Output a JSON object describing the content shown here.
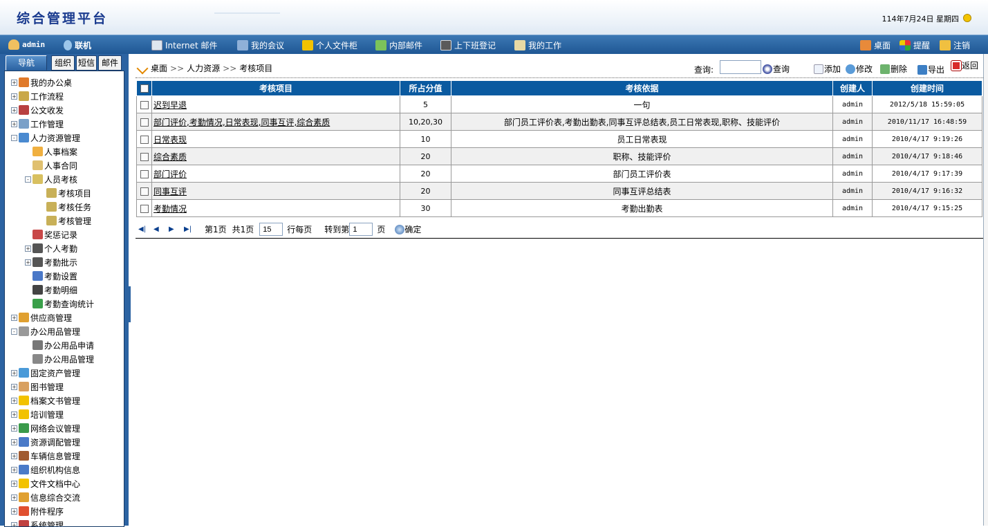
{
  "header": {
    "title": "综合管理平台",
    "date": "114年7月24日",
    "weekday": "星期四"
  },
  "menubar": {
    "user": "admin",
    "status": "联机",
    "items": [
      "Internet 邮件",
      "我的会议",
      "个人文件柜",
      "内部邮件",
      "上下班登记",
      "我的工作"
    ],
    "right": [
      "桌面",
      "提醒",
      "注销"
    ]
  },
  "sidebar": {
    "tabs": [
      "导航",
      "组织",
      "短信",
      "邮件"
    ],
    "tree": [
      "我的办公桌",
      "工作流程",
      "公文收发",
      "工作管理",
      "人力资源管理",
      "人事档案",
      "人事合同",
      "人员考核",
      "考核项目",
      "考核任务",
      "考核管理",
      "奖惩记录",
      "个人考勤",
      "考勤批示",
      "考勤设置",
      "考勤明细",
      "考勤查询统计",
      "供应商管理",
      "办公用品管理",
      "办公用品申请",
      "办公用品管理",
      "固定资产管理",
      "图书管理",
      "档案文书管理",
      "培训管理",
      "网络会议管理",
      "资源调配管理",
      "车辆信息管理",
      "组织机构信息",
      "文件文档中心",
      "信息综合交流",
      "附件程序",
      "系统管理"
    ]
  },
  "breadcrumb": [
    "桌面",
    "人力资源",
    "考核项目"
  ],
  "toolbar": {
    "search_label": "查询:",
    "search_value": "",
    "search_btn": "查询",
    "add": "添加",
    "edit": "修改",
    "delete": "删除",
    "export": "导出",
    "back": "返回"
  },
  "table": {
    "headers": [
      "考核项目",
      "所占分值",
      "考核依据",
      "创建人",
      "创建时间"
    ],
    "rows": [
      [
        "迟到早退",
        "5",
        "一句",
        "admin",
        "2012/5/18 15:59:05"
      ],
      [
        "部门评价,考勤情况,日常表现,同事互评,综合素质",
        "10,20,30",
        "部门员工评价表,考勤出勤表,同事互评总结表,员工日常表现,职称、技能评价",
        "admin",
        "2010/11/17 16:48:59"
      ],
      [
        "日常表现",
        "10",
        "员工日常表现",
        "admin",
        "2010/4/17 9:19:26"
      ],
      [
        "综合素质",
        "20",
        "职称、技能评价",
        "admin",
        "2010/4/17 9:18:46"
      ],
      [
        "部门评价",
        "20",
        "部门员工评价表",
        "admin",
        "2010/4/17 9:17:39"
      ],
      [
        "同事互评",
        "20",
        "同事互评总结表",
        "admin",
        "2010/4/17 9:16:32"
      ],
      [
        "考勤情况",
        "30",
        "考勤出勤表",
        "admin",
        "2010/4/17 9:15:25"
      ]
    ]
  },
  "pager": {
    "page": "第1页",
    "total": "共1页",
    "per_page": "15",
    "per_page_label": "行每页",
    "goto_label": "转到第",
    "goto_value": "1",
    "page_unit": "页",
    "confirm": "确定"
  }
}
